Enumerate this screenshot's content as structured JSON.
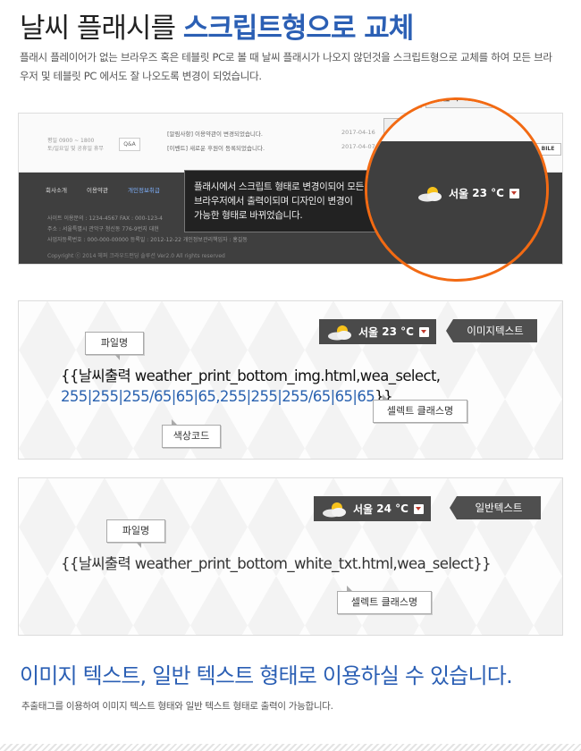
{
  "header": {
    "title_plain": "날씨 플래시를 ",
    "title_accent": "스크립트형으로 교체",
    "intro": "플래시 플레이어가 없는 브라우즈 혹은 테블릿 PC로 볼 때 날씨 플래시가 나오지 않던것을 스크립트형으로 교체를 하여 모든 브라우저 및 테블릿 PC 에서도 잘 나오도록 변경이 되었습니다."
  },
  "screenshot": {
    "hours": [
      "평일 0900 ~ 1800",
      "토/일요일 및 공휴일 휴무"
    ],
    "qa_label": "Q&A",
    "notices": [
      {
        "text": "[알림사항] 이용약관이 변경되었습니다.",
        "date": "2017-04-16"
      },
      {
        "text": "[이벤트] 새로운 후원이 등록되었습니다.",
        "date": "2017-04-07"
      }
    ],
    "button_partial": "기",
    "button_result": "결과보기",
    "mobile_label": "BILE",
    "footer_links": [
      "회사소개",
      "이용약관",
      "개인정보취급"
    ],
    "footer_info": [
      "사이트 이용문의 : 1234-4567     FAX : 000-123-4",
      "주소 : 서울특별시 관악구 청신동 776-9번지 대현",
      "사업자등록번호 : 000-000-00000     등록일 : 2012-12-22     개인정보관리책임자 : 홍길동"
    ],
    "copyright": "Copyright ⓒ 2014 헤퍼 크라우드펀딩 솔루션 Ver2.0 All rights reserved",
    "tooltip_lines": [
      "플래시에서 스크립트 형태로 변경이되어 모든",
      "브라우저에서 출력이되며 디자인이 변경이",
      "가능한 형태로 바뀌었습니다."
    ],
    "weather": {
      "city": "서울",
      "temp": "23 °C"
    }
  },
  "example1": {
    "weather": {
      "city": "서울",
      "temp": "23 °C"
    },
    "tag": "이미지텍스트",
    "file_label": "파일명",
    "code_prefix": "{{날씨출력 weather_print_bottom_img.html,wea_select,",
    "code_colors": "255|255|255/65|65|65,255|255|255/65|65|65",
    "code_suffix": "}}",
    "select_label": "셀렉트 클래스명",
    "color_label": "색상코드"
  },
  "example2": {
    "weather": {
      "city": "서울",
      "temp": "24 °C"
    },
    "tag": "일반텍스트",
    "file_label": "파일명",
    "code": "{{날씨출력 weather_print_bottom_white_txt.html,wea_select}}",
    "select_label": "셀렉트 클래스명"
  },
  "footer": {
    "title": "이미지 텍스트, 일반 텍스트 형태로 이용하실 수 있습니다.",
    "subtitle": "추출태그를 이용하여 이미지 텍스트 형태와 일반 텍스트 형태로 출력이 가능합니다."
  },
  "colors": {
    "accent": "#2b5fb4",
    "ring": "#f26a13",
    "dark": "#3f3f3f"
  }
}
